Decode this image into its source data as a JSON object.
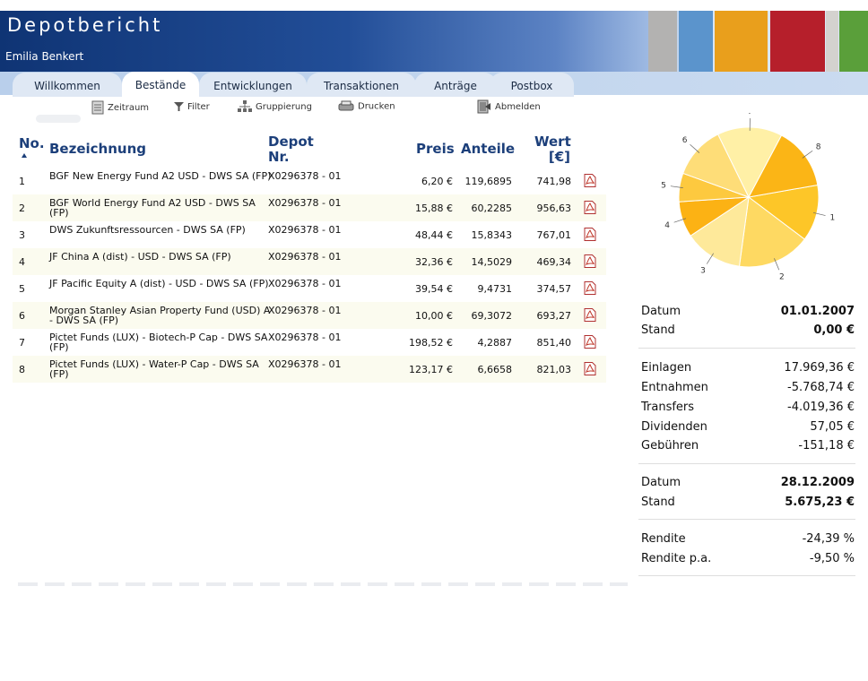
{
  "header": {
    "title": "Depotbericht",
    "user": "Emilia Benkert",
    "color_blocks": [
      "#b3b2b1",
      "#5b94cc",
      "#e99f1c",
      "#b61f2b",
      "#d4d2cf",
      "#5a9f3a"
    ]
  },
  "tabs": [
    {
      "label": "Willkommen",
      "active": false
    },
    {
      "label": "Bestände",
      "active": true
    },
    {
      "label": "Entwicklungen",
      "active": false
    },
    {
      "label": "Transaktionen",
      "active": false
    },
    {
      "label": "Anträge",
      "active": false
    },
    {
      "label": "Postbox",
      "active": false
    }
  ],
  "toolbar": {
    "zeitraum": "Zeitraum",
    "filter": "Filter",
    "gruppierung": "Gruppierung",
    "drucken": "Drucken",
    "abmelden": "Abmelden"
  },
  "table": {
    "headers": {
      "no": "No.",
      "name": "Bezeichnung",
      "depot_line1": "Depot",
      "depot_line2": "Nr.",
      "preis": "Preis",
      "anteile": "Anteile",
      "wert_line1": "Wert",
      "wert_line2": "[€]"
    },
    "rows": [
      {
        "no": "1",
        "name": "BGF New Energy Fund A2 USD - DWS SA (FP)",
        "depot": "X0296378 - 01",
        "preis": "6,20 €",
        "anteile": "119,6895",
        "wert": "741,98"
      },
      {
        "no": "2",
        "name": "BGF World Energy Fund A2 USD - DWS SA (FP)",
        "depot": "X0296378 - 01",
        "preis": "15,88 €",
        "anteile": "60,2285",
        "wert": "956,63"
      },
      {
        "no": "3",
        "name": "DWS Zukunftsressourcen - DWS SA (FP)",
        "depot": "X0296378 - 01",
        "preis": "48,44 €",
        "anteile": "15,8343",
        "wert": "767,01"
      },
      {
        "no": "4",
        "name": "JF China A (dist) - USD - DWS SA (FP)",
        "depot": "X0296378 - 01",
        "preis": "32,36 €",
        "anteile": "14,5029",
        "wert": "469,34"
      },
      {
        "no": "5",
        "name": "JF Pacific Equity A (dist) - USD - DWS SA (FP)",
        "depot": "X0296378 - 01",
        "preis": "39,54 €",
        "anteile": "9,4731",
        "wert": "374,57"
      },
      {
        "no": "6",
        "name": "Morgan Stanley Asian Property Fund (USD) A - DWS SA (FP)",
        "depot": "X0296378 - 01",
        "preis": "10,00 €",
        "anteile": "69,3072",
        "wert": "693,27"
      },
      {
        "no": "7",
        "name": "Pictet Funds (LUX) - Biotech-P Cap - DWS SA (FP)",
        "depot": "X0296378 - 01",
        "preis": "198,52 €",
        "anteile": "4,2887",
        "wert": "851,40"
      },
      {
        "no": "8",
        "name": "Pictet Funds (LUX) - Water-P Cap - DWS SA (FP)",
        "depot": "X0296378 - 01",
        "preis": "123,17 €",
        "anteile": "6,6658",
        "wert": "821,03"
      }
    ]
  },
  "chart_data": {
    "type": "pie",
    "categories": [
      "1",
      "2",
      "3",
      "4",
      "5",
      "6",
      "7",
      "8"
    ],
    "values": [
      741.98,
      956.63,
      767.01,
      469.34,
      374.57,
      693.27,
      851.4,
      821.03
    ],
    "colors": [
      "#fdc628",
      "#fed962",
      "#fee99a",
      "#fcb214",
      "#fdc93f",
      "#fedd78",
      "#fff0a6",
      "#fbb516"
    ]
  },
  "summary": {
    "start": {
      "datum_label": "Datum",
      "datum": "01.01.2007",
      "stand_label": "Stand",
      "stand": "0,00 €"
    },
    "flows": [
      {
        "label": "Einlagen",
        "value": "17.969,36 €"
      },
      {
        "label": "Entnahmen",
        "value": "-5.768,74 €"
      },
      {
        "label": "Transfers",
        "value": "-4.019,36 €"
      },
      {
        "label": "Dividenden",
        "value": "57,05 €"
      },
      {
        "label": "Gebühren",
        "value": "-151,18 €"
      }
    ],
    "end": {
      "datum_label": "Datum",
      "datum": "28.12.2009",
      "stand_label": "Stand",
      "stand": "5.675,23 €"
    },
    "rendite": [
      {
        "label": "Rendite",
        "value": "-24,39 %"
      },
      {
        "label": "Rendite p.a.",
        "value": "-9,50 %"
      }
    ]
  }
}
